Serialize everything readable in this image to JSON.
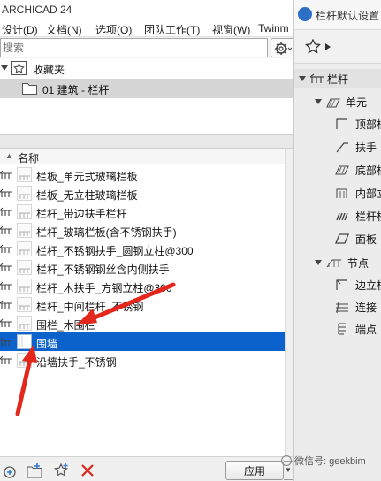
{
  "window": {
    "title": "ARCHICAD 24"
  },
  "menu": [
    "设计(D)",
    "文档(N)",
    "选项(O)",
    "团队工作(T)",
    "视窗(W)",
    "Twinm"
  ],
  "search": {
    "placeholder": "搜索",
    "value": ""
  },
  "tree": {
    "favorites_label": "收藏夹",
    "folder_label": "01 建筑 - 栏杆"
  },
  "list": {
    "column_header": "名称",
    "items": [
      {
        "name": "栏板_单元式玻璃栏板"
      },
      {
        "name": "栏板_无立柱玻璃栏板"
      },
      {
        "name": "栏杆_带边扶手栏杆"
      },
      {
        "name": "栏杆_玻璃栏板(含不锈钢扶手)"
      },
      {
        "name": "栏杆_不锈钢扶手_圆钢立柱@300"
      },
      {
        "name": "栏杆_不锈钢钢丝含内侧扶手"
      },
      {
        "name": "栏杆_木扶手_方钢立柱@300"
      },
      {
        "name": "栏杆_中间栏杆_不锈钢"
      },
      {
        "name": "围栏_木围栏"
      },
      {
        "name": "围墙"
      },
      {
        "name": "沿墙扶手_不锈钢"
      }
    ],
    "selected_index": 9
  },
  "bottom": {
    "apply_label": "应用"
  },
  "palette": {
    "title": "栏杆默认设置",
    "root_label": "栏杆",
    "unit_label": "单元",
    "unit_items": [
      "顶部栏",
      "扶手",
      "底部栏",
      "内部立",
      "栏杆柱",
      "面板"
    ],
    "node_label": "节点",
    "node_items": [
      "边立柱",
      "连接",
      "端点"
    ]
  },
  "watermark": "微信号: geekbim",
  "colors": {
    "selection": "#0b62cc",
    "arrow": "#e3271d",
    "delete": "#d9261c"
  }
}
